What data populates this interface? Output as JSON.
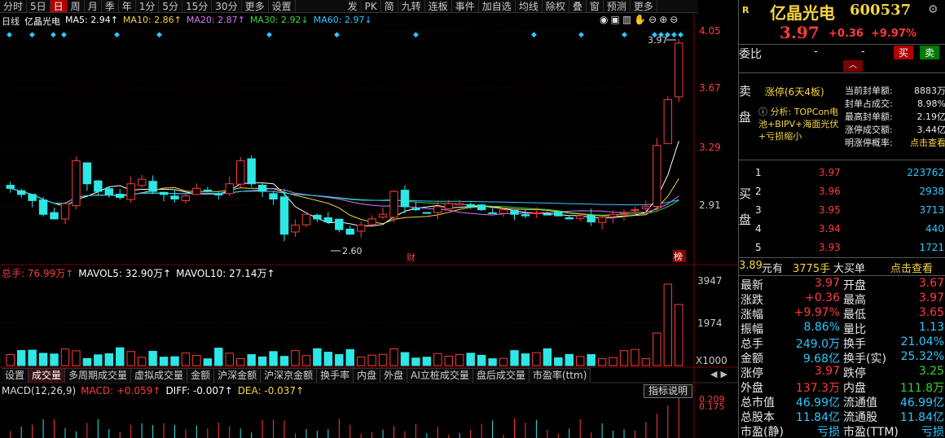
{
  "toolbar": {
    "items": [
      "分时",
      "5日",
      "日",
      "周",
      "月",
      "季",
      "年",
      "1分",
      "5分",
      "15分",
      "30分",
      "更多",
      "设置"
    ],
    "right_items": [
      "发",
      "PK",
      "简",
      "九转",
      "连板",
      "事件",
      "加自选",
      "均线",
      "除权",
      "叠",
      "窗",
      "预测",
      "更多"
    ]
  },
  "chart": {
    "period_label": "日线",
    "stock_name": "亿晶光电",
    "ma5": "MA5: 2.94↑",
    "ma10": "MA10: 2.86↑",
    "ma20": "MA20: 2.87↑",
    "ma30": "MA30: 2.92↓",
    "ma60": "MA60: 2.97↓",
    "price_ticks": [
      "4.05",
      "3.67",
      "3.29",
      "2.91"
    ],
    "high_marker": "3.97",
    "low_marker": "2.60",
    "marker_cai": "财",
    "marker_bang": "榜",
    "colors": {
      "ma5": "#ffffff",
      "ma10": "#f5d542",
      "ma20": "#d478ff",
      "ma30": "#3cd43c",
      "ma60": "#2ec7ff",
      "up": "#ff3b3b",
      "down": "#2ee6e6"
    }
  },
  "volume": {
    "title": "总手: 76.99万↑",
    "mavol5": "MAVOL5: 32.90万↑",
    "mavol10": "MAVOL10: 27.14万↑",
    "ticks": [
      "3947",
      "1974",
      "X1000"
    ]
  },
  "bottom_tabs": [
    "设置",
    "成交量",
    "多周期成交量",
    "虚拟成交量",
    "金额",
    "沪深金额",
    "沪深京金额",
    "换手率",
    "内盘",
    "外盘",
    "AI立桩成交量",
    "盘后成交量",
    "市盈率(ttm)"
  ],
  "macd": {
    "title": "MACD(12,26,9)",
    "macd": "MACD: +0.059↑",
    "diff": "DIFF: -0.007↑",
    "dea": "DEA: -0.037↑",
    "explain": "指标说明",
    "ticks": [
      "0.209",
      "0.175"
    ]
  },
  "quote": {
    "flag": "R",
    "name": "亿晶光电",
    "code": "600537",
    "price": "3.97",
    "change": "+0.36",
    "change_pct": "+9.97%",
    "weibi_label": "委比",
    "weibi_val1": "-",
    "weibi_val2": "-",
    "sell_btn": "买",
    "buy_btn": "卖",
    "sell_side": "卖盘",
    "buy_side": "买盘",
    "limit_title": "涨停(6天4板)",
    "analysis": "分析: TOPCon电池+BIPV+海面光伏+亏损缩小",
    "limit_info": [
      {
        "k": "当前封单额:",
        "v": "8883万"
      },
      {
        "k": "封单占成交:",
        "v": "8.98%"
      },
      {
        "k": "最高封单额:",
        "v": "2.19亿"
      },
      {
        "k": "涨停成交额:",
        "v": "3.44亿"
      },
      {
        "k": "明涨停概率:",
        "v": "点击查看"
      }
    ],
    "bids": [
      {
        "n": "1",
        "p": "3.97",
        "v": "223762"
      },
      {
        "n": "2",
        "p": "3.96",
        "v": "2938"
      },
      {
        "n": "3",
        "p": "3.95",
        "v": "3713"
      },
      {
        "n": "4",
        "p": "3.94",
        "v": "440"
      },
      {
        "n": "5",
        "p": "3.93",
        "v": "1721"
      }
    ],
    "bigbuy": {
      "price": "3.89",
      "unit": "元有",
      "qty": "3775手",
      "label": "大买单",
      "link": "点击查看"
    },
    "stats": [
      {
        "k1": "最新",
        "v1": "3.97",
        "k2": "开盘",
        "v2": "3.67"
      },
      {
        "k1": "涨跌",
        "v1": "+0.36",
        "k2": "最高",
        "v2": "3.97"
      },
      {
        "k1": "涨幅",
        "v1": "+9.97%",
        "k2": "最低",
        "v2": "3.65"
      },
      {
        "k1": "振幅",
        "v1": "8.86%",
        "k2": "量比",
        "v2": "1.13"
      },
      {
        "k1": "总手",
        "v1": "249.0万",
        "k2": "换手",
        "v2": "21.04%"
      },
      {
        "k1": "金额",
        "v1": "9.68亿",
        "k2": "换手(实)",
        "v2": "25.32%"
      },
      {
        "k1": "涨停",
        "v1": "3.97",
        "k2": "跌停",
        "v2": "3.25"
      },
      {
        "k1": "外盘",
        "v1": "137.3万",
        "k2": "内盘",
        "v2": "111.8万"
      },
      {
        "k1": "总市值",
        "v1": "46.99亿",
        "k2": "流通值",
        "v2": "46.99亿"
      },
      {
        "k1": "总股本",
        "v1": "11.84亿",
        "k2": "流通股",
        "v2": "11.84亿"
      },
      {
        "k1": "市盈(静)",
        "v1": "亏损",
        "k2": "市盈(TTM)",
        "v2": "亏损"
      }
    ]
  }
}
